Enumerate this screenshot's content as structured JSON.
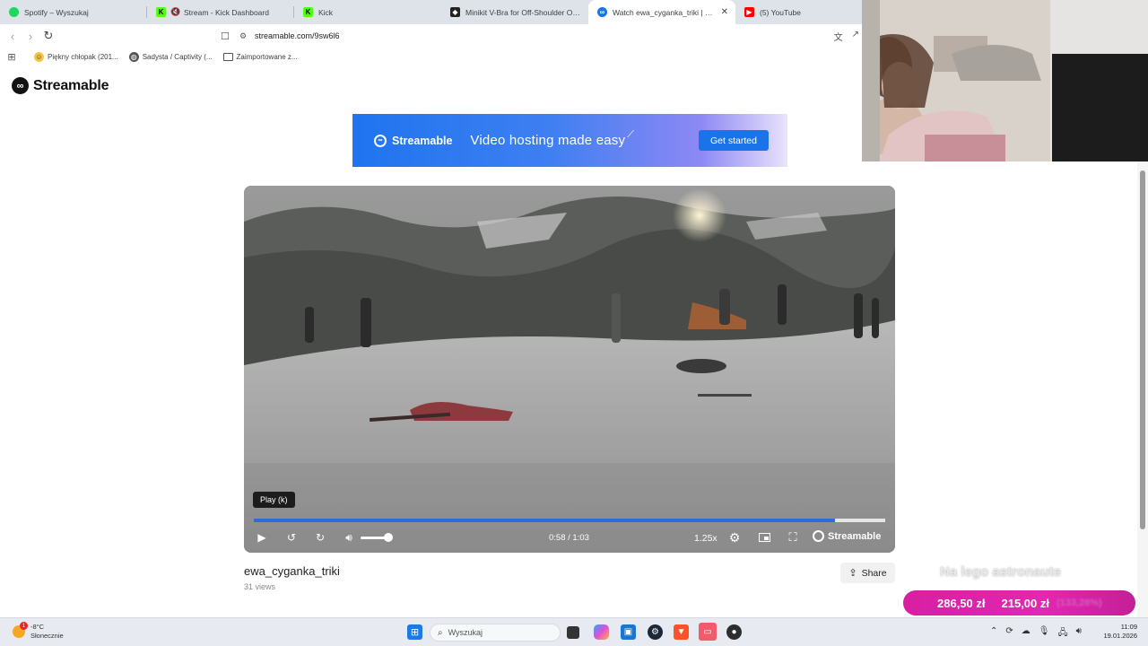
{
  "browser": {
    "tabs": [
      {
        "title": "Spotify – Wyszukaj",
        "icon": "spotify-icon",
        "color": "#1ed760"
      },
      {
        "title": "Stream - Kick Dashboard",
        "icon": "kick-icon",
        "color": "#53fc18"
      },
      {
        "title": "Kick",
        "icon": "kick-icon",
        "color": "#53fc18"
      },
      {
        "title": "Minikit V-Bra for Off-Shoulder Outfits",
        "icon": "shop-icon",
        "color": "#222222"
      },
      {
        "title": "Watch ewa_cyganka_triki | Streamable",
        "icon": "streamable-icon",
        "color": "#1a73e8",
        "active": true
      },
      {
        "title": "(5) YouTube",
        "icon": "youtube-icon",
        "color": "#ff0000"
      }
    ],
    "url": "streamable.com/9sw6l6",
    "bookmarks": [
      {
        "label": "Piękny chłopak (201...",
        "icon": "smiley-icon"
      },
      {
        "label": "Sadysta / Captivity (...",
        "icon": "globe-icon"
      },
      {
        "label": "Zaimportowane z...",
        "icon": "folder-icon"
      }
    ]
  },
  "page": {
    "logo": "Streamable",
    "banner": {
      "brand": "Streamable",
      "tagline": "Video hosting made easy",
      "cta": "Get started"
    },
    "player": {
      "tooltip": "Play (k)",
      "time": "0:58 / 1:03",
      "progress_fraction": 0.92,
      "volume_fraction": 0.9,
      "speed": "1.25x",
      "brand": "Streamable"
    },
    "video_title": "ewa_cyganka_triki",
    "views": "31 views",
    "share_label": "Share"
  },
  "stream_overlay": {
    "caption": "Na lego astronaute",
    "goal_current": "286,50 zł",
    "goal_target": "215,00 zł",
    "goal_percent": "(133,26%)",
    "goal_color": "#d81fa2"
  },
  "taskbar": {
    "weather_temp": "-8°C",
    "weather_desc": "Słonecznie",
    "weather_badge": "1",
    "search_placeholder": "Wyszukaj",
    "time": "11:09",
    "date": "19.01.2026"
  }
}
